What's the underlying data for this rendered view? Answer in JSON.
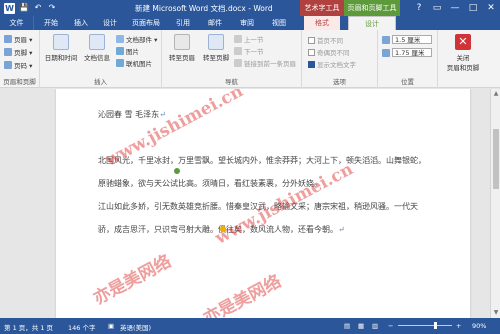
{
  "window": {
    "title": "新建 Microsoft Word 文档.docx - Word",
    "context_groups": {
      "art_tools": "艺术字工具",
      "header_footer_tools": "页眉和页脚工具"
    },
    "controls": {
      "help": "?",
      "restore": "▭",
      "minimize": "—",
      "maximize": "□",
      "close": "✕"
    }
  },
  "qat": {
    "app_icon": "W",
    "save": "💾",
    "undo": "↶",
    "redo": "↷"
  },
  "tabs": {
    "file": "文件",
    "home": "开始",
    "insert": "插入",
    "design1": "设计",
    "layout": "页面布局",
    "references": "引用",
    "mailings": "邮件",
    "review": "审阅",
    "view": "视图",
    "format": "格式",
    "design2": "设计"
  },
  "ribbon": {
    "hf_group": {
      "label": "页眉和页脚",
      "header": "页眉 ▾",
      "footer": "页脚 ▾",
      "page_number": "页码 ▾"
    },
    "insert_group": {
      "label": "插入",
      "datetime": "日期和时间",
      "docinfo": "文档信息",
      "doc_parts": "文档部件 ▾",
      "pictures": "图片",
      "online_pictures": "联机图片"
    },
    "nav_group": {
      "label": "导航",
      "goto_header": "转至页眉",
      "goto_footer": "转至页脚",
      "prev": "上一节",
      "next": "下一节",
      "link_prev": "链接到前一条页眉"
    },
    "options_group": {
      "label": "选项",
      "diff_first": "首页不同",
      "diff_oddeven": "奇偶页不同",
      "show_text": "显示文档文字"
    },
    "position_group": {
      "label": "位置",
      "header_pos": "1.5 厘米",
      "footer_pos": "1.75 厘米"
    },
    "close_group": {
      "label": "关闭",
      "close_line1": "关闭",
      "close_line2": "页眉和页脚"
    }
  },
  "document": {
    "lines": [
      "沁园春 雪 毛泽东",
      "北国风光，千里冰封，万里雪飘。望长城内外，惟余莽莽；大河上下，顿失滔滔。山舞银蛇，",
      "原驰蜡象，欲与天公试比高。须晴日，看红装素裹，分外妖娆。",
      "江山如此多娇，引无数英雄竞折腰。惜秦皇汉武，略输文采；唐宗宋祖，稍逊风骚。一代天",
      "骄，成吉思汗，只识弯弓射大雕。俱往矣，数风流人物，还看今朝。"
    ],
    "para_mark": "↵",
    "watermarks": [
      "www.jishimei.cn",
      "www.jishimei.cn",
      "亦是美网络",
      "亦是美网络"
    ]
  },
  "statusbar": {
    "page": "第 1 页，共 1 页",
    "words": "146 个字",
    "lang": "英语(美国)",
    "zoom": "90%"
  }
}
